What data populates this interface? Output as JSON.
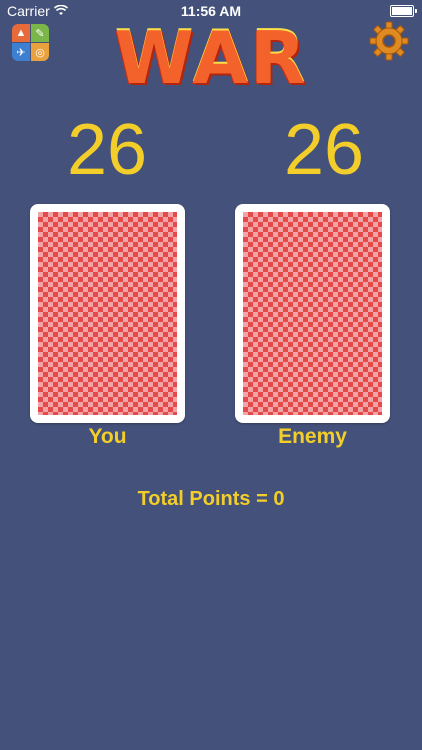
{
  "status_bar": {
    "carrier": "Carrier",
    "time": "11:56 AM"
  },
  "header": {
    "title": "WAR"
  },
  "scores": {
    "player": "26",
    "enemy": "26"
  },
  "labels": {
    "player": "You",
    "enemy": "Enemy"
  },
  "total": {
    "text": "Total Points = 0"
  },
  "colors": {
    "background": "#44517a",
    "accent_yellow": "#f3ce2a",
    "title_orange": "#f4622b",
    "card_red": "#e54a4b"
  },
  "icons": {
    "apps": "more-apps-icon",
    "settings": "gear-icon",
    "wifi": "wifi-icon",
    "battery": "battery-icon"
  }
}
